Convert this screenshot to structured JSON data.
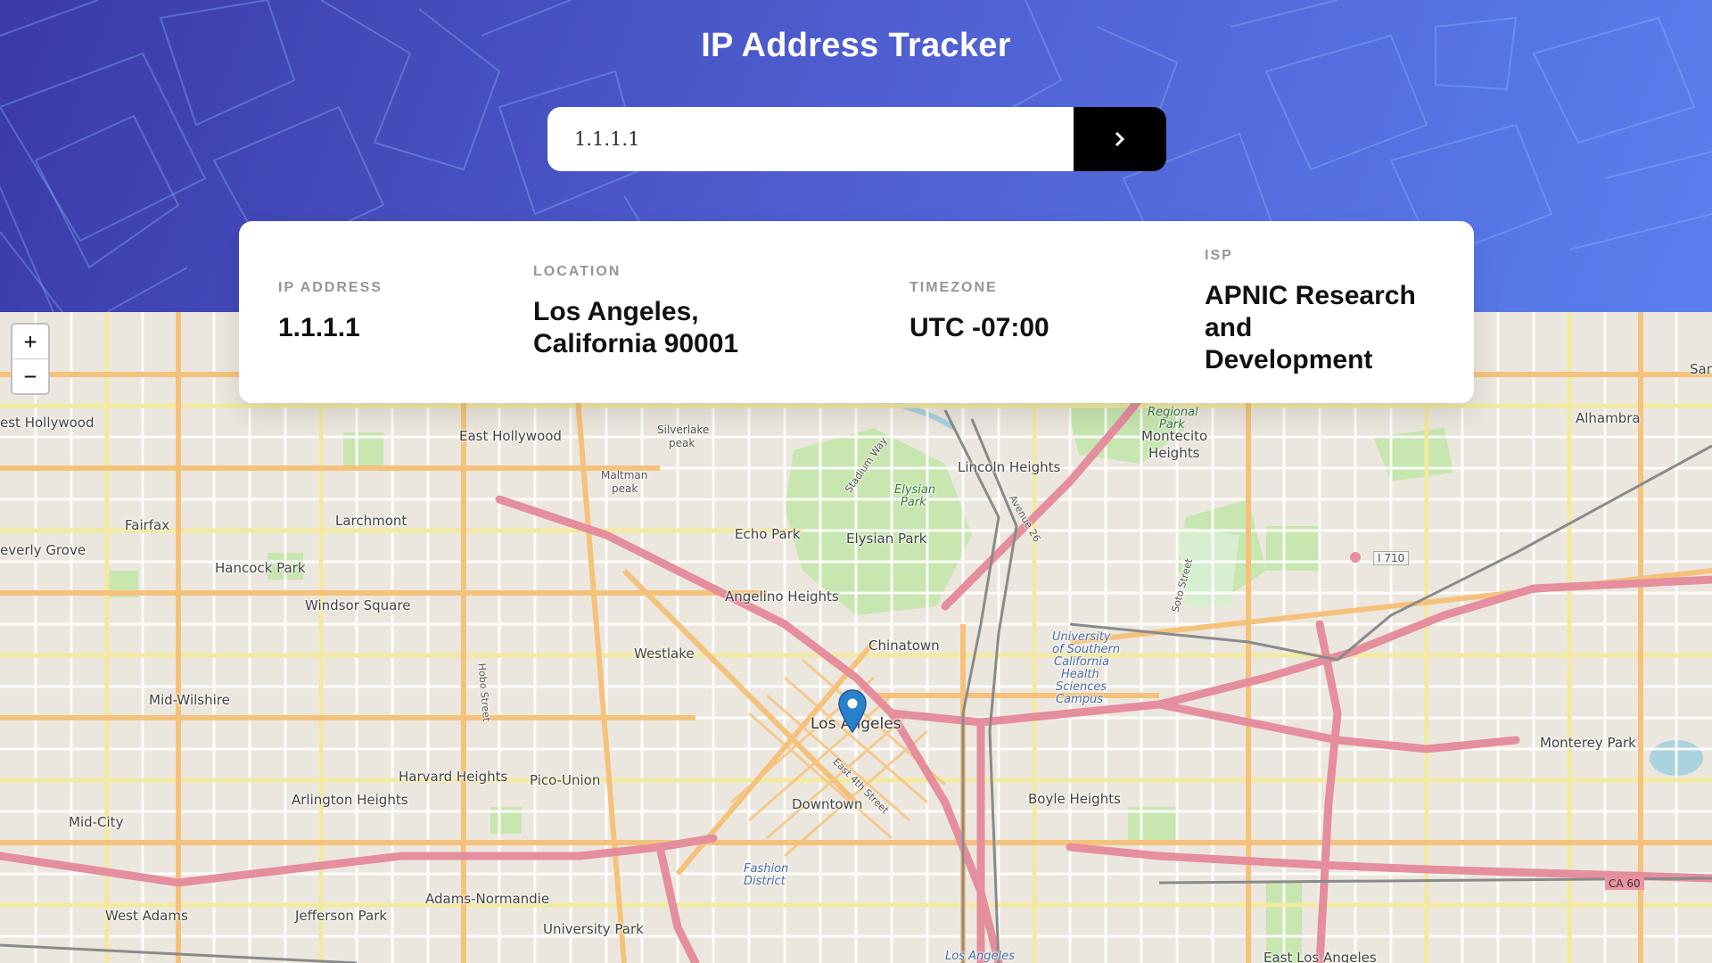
{
  "header": {
    "title": "IP Address Tracker"
  },
  "search": {
    "value": "1.1.1.1",
    "button_icon": "chevron-right-icon"
  },
  "info": {
    "ip_label": "IP ADDRESS",
    "ip_value": "1.1.1.1",
    "location_label": "LOCATION",
    "location_line1": "Los Angeles,",
    "location_line2": "California 90001",
    "timezone_label": "TIMEZONE",
    "timezone_value": "UTC -07:00",
    "isp_label": "ISP",
    "isp_line1": "APNIC Research",
    "isp_line2": "and",
    "isp_line3": "Development"
  },
  "map": {
    "zoom_in": "+",
    "zoom_out": "−",
    "marker_icon": "map-pin-icon",
    "places": {
      "west_hollywood": "est Hollywood",
      "east_hollywood": "East Hollywood",
      "silver_lake_peak_1": "Silverlake",
      "silver_lake_peak_2": "peak",
      "maltman_peak_1": "Maltman",
      "maltman_peak_2": "peak",
      "lincoln_heights": "Lincoln Heights",
      "regional_park_1": "Regional",
      "regional_park_2": "Park",
      "montecito_heights_1": "Montecito",
      "montecito_heights_2": "Heights",
      "alhambra": "Alhambra",
      "san": "San",
      "fairfax": "Fairfax",
      "larchmont": "Larchmont",
      "beverly_grove": "everly Grove",
      "hancock_park": "Hancock Park",
      "echo_park": "Echo Park",
      "elysian_park": "Elysian Park",
      "elysian_park_small_1": "Elysian",
      "elysian_park_small_2": "Park",
      "stadium_way": "Stadium Way",
      "windsor_square": "Windsor Square",
      "angelino_heights": "Angelino Heights",
      "westlake": "Westlake",
      "chinatown": "Chinatown",
      "usc_1": "University",
      "usc_2": "of Southern",
      "usc_3": "California",
      "usc_4": "Health",
      "usc_5": "Sciences",
      "usc_6": "Campus",
      "mid_wilshire": "Mid-Wilshire",
      "los_angeles": "Los Angeles",
      "monterey_park": "Monterey Park",
      "harvard_heights": "Harvard Heights",
      "pico_union": "Pico-Union",
      "arlington_heights": "Arlington Heights",
      "downtown": "Downtown",
      "boyle_heights": "Boyle Heights",
      "mid_city": "Mid-City",
      "adams_normandie": "Adams-Normandie",
      "west_adams": "West Adams",
      "jefferson_park": "Jefferson Park",
      "university_park": "University Park",
      "fashion_district_1": "Fashion",
      "fashion_district_2": "District",
      "east_los_angeles": "East Los Angeles",
      "los_angeles_river": "Los Angeles",
      "soto_street": "Soto Street",
      "hobo_street": "Hobo Street",
      "avenue_26": "Avenue 26",
      "east_4th_street": "East 4th Street",
      "i710": "I 710",
      "ca60": "CA 60"
    }
  },
  "colors": {
    "header_gradient_start": "#3a3aa8",
    "header_gradient_end": "#5a7fee",
    "motorway": "#e892a2",
    "primary_road": "#fcd6a4",
    "secondary_road": "#f7fabf",
    "park": "#c8e6b0",
    "button": "#000000"
  }
}
